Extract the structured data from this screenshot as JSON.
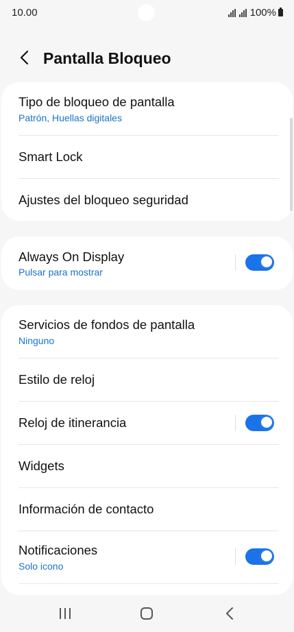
{
  "status_bar": {
    "time": "10.00",
    "battery": "100%"
  },
  "header": {
    "title": "Pantalla Bloqueo",
    "back_icon": "chevron-left-icon"
  },
  "security_card": {
    "items": [
      {
        "title": "Tipo de bloqueo de pantalla",
        "subtitle": "Patrón, Huellas digitales"
      },
      {
        "title": "Smart Lock"
      },
      {
        "title": "Ajustes del bloqueo seguridad"
      }
    ]
  },
  "aod_card": {
    "title": "Always On Display",
    "subtitle": "Pulsar para mostrar",
    "toggle_on": true
  },
  "lock_card": {
    "items": [
      {
        "title": "Servicios de fondos de pantalla",
        "subtitle": "Ninguno"
      },
      {
        "title": "Estilo de reloj"
      },
      {
        "title": "Reloj de itinerancia",
        "toggle_on": true
      },
      {
        "title": "Widgets"
      },
      {
        "title": "Información de contacto"
      },
      {
        "title": "Notificaciones",
        "subtitle": "Solo icono",
        "toggle_on": true
      }
    ]
  },
  "colors": {
    "accent": "#1a73e8",
    "subtitle": "#1a73c8",
    "background": "#f6f6f6",
    "card": "#ffffff"
  },
  "nav_bar": {
    "recents_icon": "recents-icon",
    "home_icon": "home-icon",
    "back_icon": "back-icon"
  }
}
